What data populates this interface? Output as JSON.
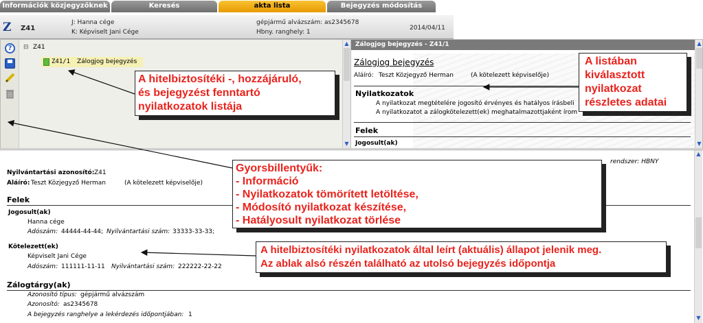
{
  "tabs": [
    {
      "label": "Információk közjegyzőknek"
    },
    {
      "label": "Keresés"
    },
    {
      "label": "akta lista"
    },
    {
      "label": "Bejegyzés módosítás"
    }
  ],
  "header": {
    "code": "Z41",
    "j_line": "J: Hanna cége",
    "k_line": "K: Képviselt Jani Cége",
    "vehicle_line": "gépjármű alvázszám: as2345678",
    "rank_line": "Hbny. ranghely: 1",
    "date": "2014/04/11"
  },
  "tree": {
    "root": "Z41",
    "item_code": "Z41/1",
    "item_label": "Zálogjog bejegyzés"
  },
  "detail": {
    "panel_title": "Zálogjog bejegyzés - Z41/1",
    "heading": "Zálogjog bejegyzés",
    "signer_label": "Aláíró:",
    "signer": "Teszt Közjegyző Herman",
    "signer_note": "(A kötelezett képviselője)",
    "statements_heading": "Nyilatkozatok",
    "statement_1": "A nyilatkozat megtételére jogosító érvényes és hatályos írásbeli",
    "statement_2": "A nyilatkozatot a zálogkötelezett(ek) meghatalmazottjaként írom",
    "parties_heading": "Felek",
    "entitled_heading": "Jogosult(ak)"
  },
  "main": {
    "registry_tail": "rendszer: HBNY",
    "reg_id_label": "Nyilvántartási azonosító:",
    "reg_id": "Z41",
    "signer_label": "Aláíró:",
    "signer": "Teszt Közjegyző Herman",
    "signer_note": "(A kötelezett képviselője)",
    "parties_heading": "Felek",
    "entitled_heading": "Jogosult(ak)",
    "entitled_name": "Hanna cége",
    "entitled_tax_label": "Adószám:",
    "entitled_tax": "44444-44-44;",
    "entitled_reg_label": "Nyilvántartási szám:",
    "entitled_reg": "33333-33-33;",
    "obligor_heading": "Kötelezett(ek)",
    "obligor_name": "Képviselt Jani Cége",
    "obligor_tax_label": "Adószám:",
    "obligor_tax": "111111-11-11",
    "obligor_reg_label": "Nyilvántartási szám:",
    "obligor_reg": "222222-22-22",
    "collateral_heading": "Zálogtárgy(ak)",
    "id_type_label": "Azonosító típus:",
    "id_type": "gépjármű alvázszám",
    "id_label": "Azonosító:",
    "id_value": "as2345678",
    "rank_label": "A bejegyzés ranghelye a lekérdezés időpontjában:",
    "rank_value": "1"
  },
  "callouts": {
    "list_1": "A hitelbiztosítéki -, hozzájáruló,",
    "list_2": "és bejegyzést fenntartó",
    "list_3": "nyilatkozatok listája",
    "detail_1": "A listában",
    "detail_2": "kiválasztott",
    "detail_3": "nyilatkozat",
    "detail_4": "részletes adatai",
    "keys_1": "Gyorsbillentyűk:",
    "keys_2": "- Információ",
    "keys_3": "- Nyilatkozatok tömörített letöltése,",
    "keys_4": "- Módosító nyilatkozat készítése,",
    "keys_5": "- Hatályosult nyilatkozat törlése",
    "state_1": "A hitelbiztosítéki nyilatkozatok által leírt (aktuális) állapot jelenik meg.",
    "state_2": "Az ablak alsó részén található az utolsó bejegyzés időpontja"
  },
  "colors": {
    "accent_tab": "#f0a800",
    "callout_text": "#e8231d",
    "tab_grey": "#7a7a7a"
  }
}
